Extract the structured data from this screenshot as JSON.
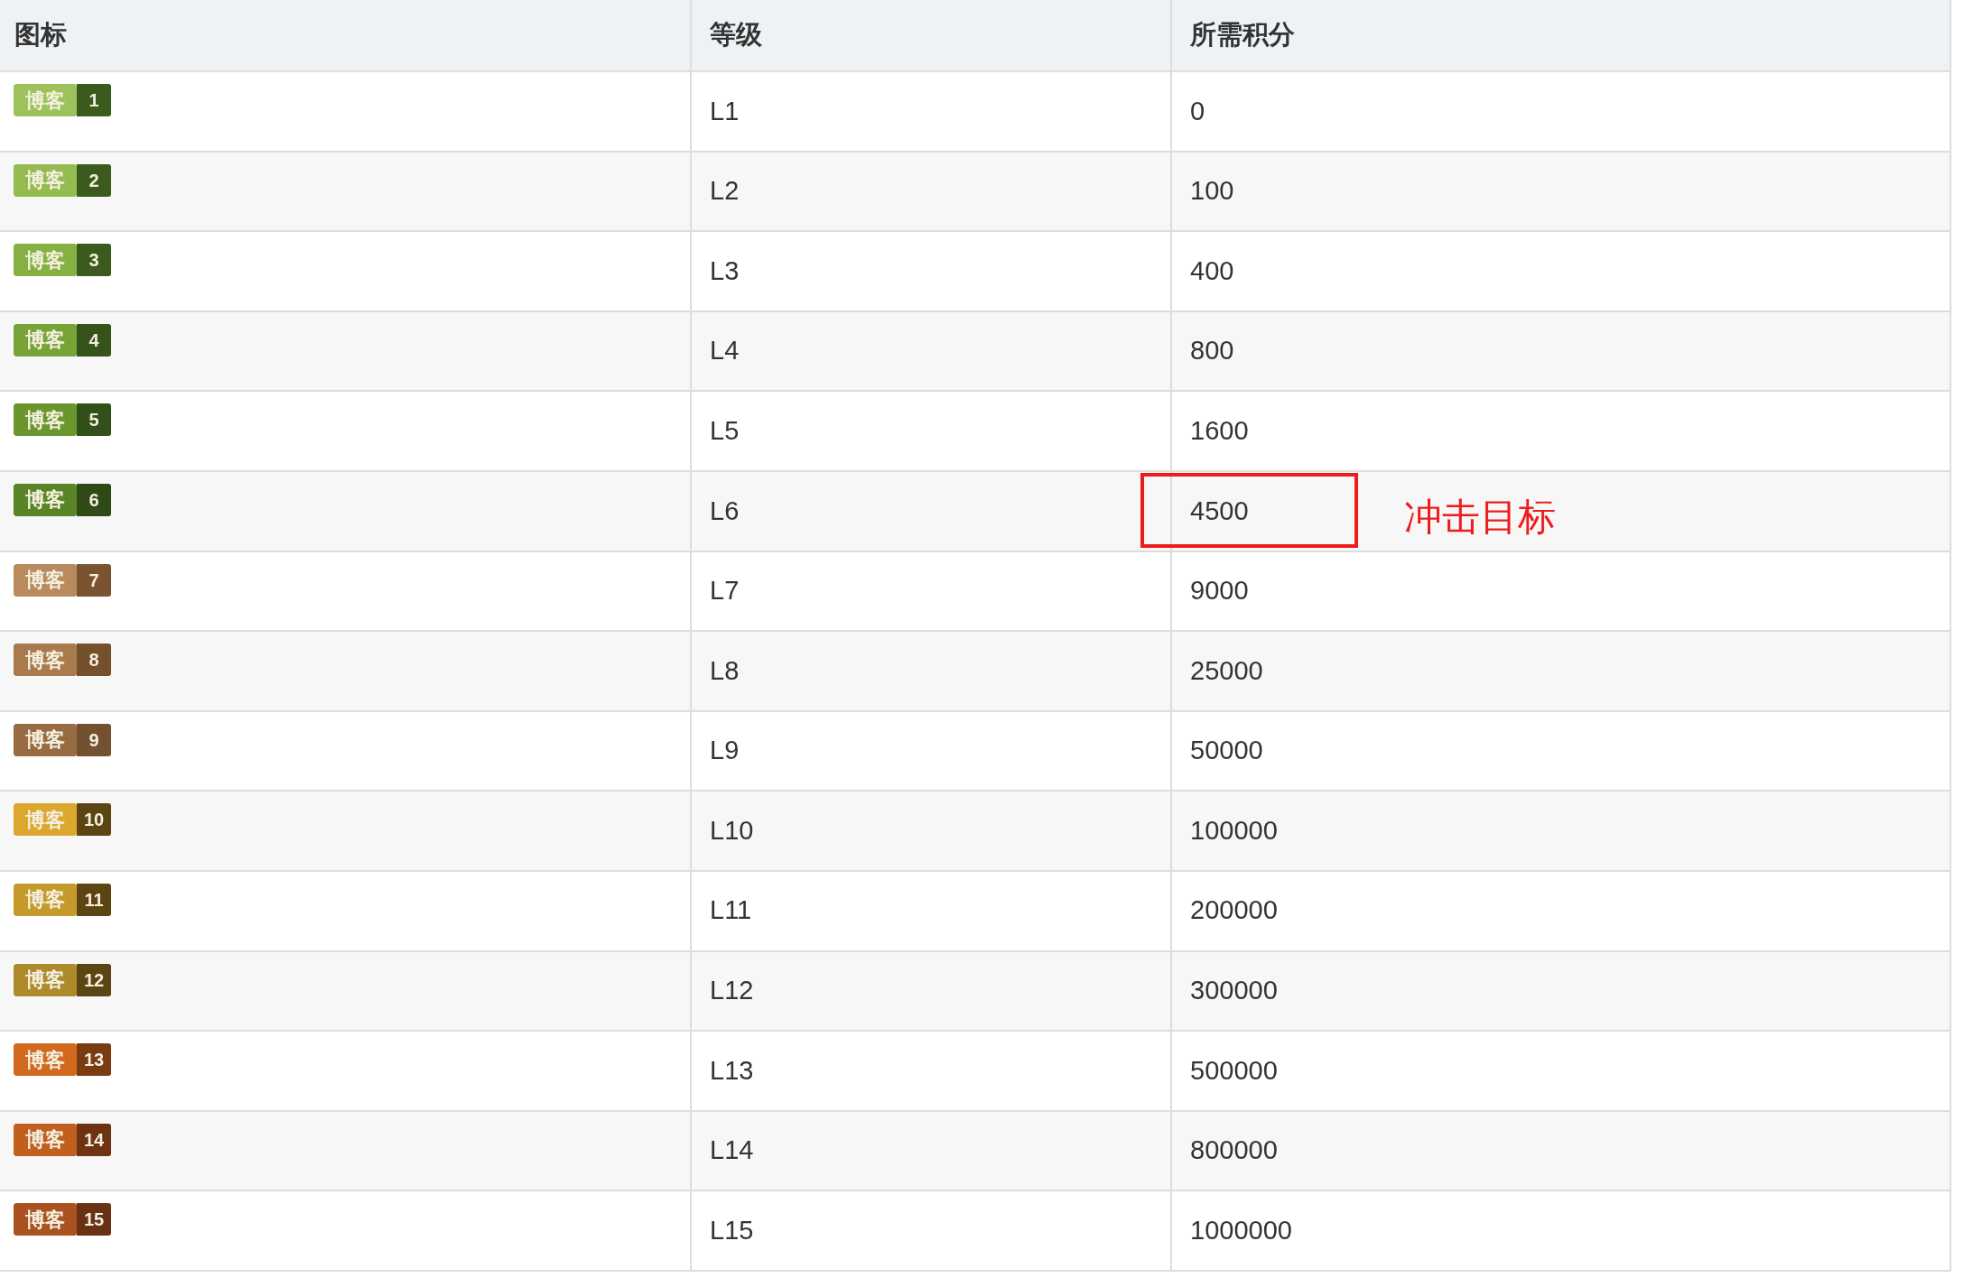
{
  "table": {
    "columns": [
      "图标",
      "等级",
      "所需积分"
    ],
    "rows": [
      {
        "badge": {
          "label": "博客",
          "color": "#9dc25c",
          "number": {
            "text": "1",
            "color": "#3a5a1e"
          }
        },
        "level": "L1",
        "points": "0",
        "highlighted": false
      },
      {
        "badge": {
          "label": "博客",
          "color": "#93bb50",
          "number": {
            "text": "2",
            "color": "#3a5a1e"
          }
        },
        "level": "L2",
        "points": "100",
        "highlighted": false
      },
      {
        "badge": {
          "label": "博客",
          "color": "#86b042",
          "number": {
            "text": "3",
            "color": "#3a5a1e"
          }
        },
        "level": "L3",
        "points": "400",
        "highlighted": false
      },
      {
        "badge": {
          "label": "博客",
          "color": "#78a336",
          "number": {
            "text": "4",
            "color": "#35531b"
          }
        },
        "level": "L4",
        "points": "800",
        "highlighted": false
      },
      {
        "badge": {
          "label": "博客",
          "color": "#6b962d",
          "number": {
            "text": "5",
            "color": "#32501a"
          }
        },
        "level": "L5",
        "points": "1600",
        "highlighted": false
      },
      {
        "badge": {
          "label": "博客",
          "color": "#5a8526",
          "number": {
            "text": "6",
            "color": "#2f4a17"
          }
        },
        "level": "L6",
        "points": "4500",
        "highlighted": true,
        "annotation": "冲击目标"
      },
      {
        "badge": {
          "label": "博客",
          "color": "#b88a5e",
          "number": {
            "text": "7",
            "color": "#7a5430"
          }
        },
        "level": "L7",
        "points": "9000",
        "highlighted": false
      },
      {
        "badge": {
          "label": "博客",
          "color": "#a97a4e",
          "number": {
            "text": "8",
            "color": "#75502c"
          }
        },
        "level": "L8",
        "points": "25000",
        "highlighted": false
      },
      {
        "badge": {
          "label": "博客",
          "color": "#986c43",
          "number": {
            "text": "9",
            "color": "#735030"
          }
        },
        "level": "L9",
        "points": "50000",
        "highlighted": false
      },
      {
        "badge": {
          "label": "博客",
          "color": "#dca72c",
          "number": {
            "text": "10",
            "color": "#5c4512"
          }
        },
        "level": "L10",
        "points": "100000",
        "highlighted": false
      },
      {
        "badge": {
          "label": "博客",
          "color": "#c69a2a",
          "number": {
            "text": "11",
            "color": "#5c4513"
          }
        },
        "level": "L11",
        "points": "200000",
        "highlighted": false
      },
      {
        "badge": {
          "label": "博客",
          "color": "#ad8a2a",
          "number": {
            "text": "12",
            "color": "#5c4514"
          }
        },
        "level": "L12",
        "points": "300000",
        "highlighted": false
      },
      {
        "badge": {
          "label": "博客",
          "color": "#d2691e",
          "number": {
            "text": "13",
            "color": "#7a3a12"
          }
        },
        "level": "L13",
        "points": "500000",
        "highlighted": false
      },
      {
        "badge": {
          "label": "博客",
          "color": "#c05f1e",
          "number": {
            "text": "14",
            "color": "#6e3412"
          }
        },
        "level": "L14",
        "points": "800000",
        "highlighted": false
      },
      {
        "badge": {
          "label": "博客",
          "color": "#aa5220",
          "number": {
            "text": "15",
            "color": "#6a3214"
          }
        },
        "level": "L15",
        "points": "1000000",
        "highlighted": false
      }
    ]
  }
}
